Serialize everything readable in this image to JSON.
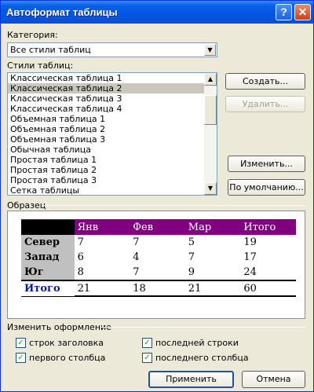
{
  "window": {
    "title": "Автоформат таблицы",
    "help_label": "?",
    "close_label": "✕"
  },
  "category": {
    "label": "Категория:",
    "value": "Все стили таблиц"
  },
  "styles": {
    "label": "Стили таблиц:",
    "items": [
      "Классическая таблица 1",
      "Классическая таблица 2",
      "Классическая таблица 3",
      "Классическая таблица 4",
      "Объемная таблица 1",
      "Объемная таблица 2",
      "Объемная таблица 3",
      "Обычная таблица",
      "Простая таблица 1",
      "Простая таблица 2",
      "Простая таблица 3",
      "Сетка таблицы"
    ],
    "selected_index": 1
  },
  "buttons": {
    "create": "Создать...",
    "delete": "Удалить...",
    "modify": "Изменить...",
    "default": "По умолчанию...",
    "apply": "Применить",
    "cancel": "Отмена"
  },
  "sample": {
    "label": "Образец",
    "header": [
      "",
      "Янв",
      "Фев",
      "Мар",
      "Итого"
    ],
    "rows": [
      [
        "Север",
        "7",
        "7",
        "5",
        "19"
      ],
      [
        "Запад",
        "6",
        "4",
        "7",
        "17"
      ],
      [
        "Юг",
        "8",
        "7",
        "9",
        "24"
      ]
    ],
    "total": [
      "Итого",
      "21",
      "18",
      "21",
      "60"
    ]
  },
  "formatting": {
    "label": "Изменить оформление",
    "header_rows": {
      "label": "строк заголовка",
      "checked": true
    },
    "last_row": {
      "label": "последней строки",
      "checked": true
    },
    "first_column": {
      "label": "первого столбца",
      "checked": true
    },
    "last_column": {
      "label": "последнего столбца",
      "checked": true
    }
  },
  "colors": {
    "title_bar": "#0356e3",
    "header_row": "#800080",
    "stub_column": "#c0c0c0",
    "total_label": "#0a1e90"
  }
}
